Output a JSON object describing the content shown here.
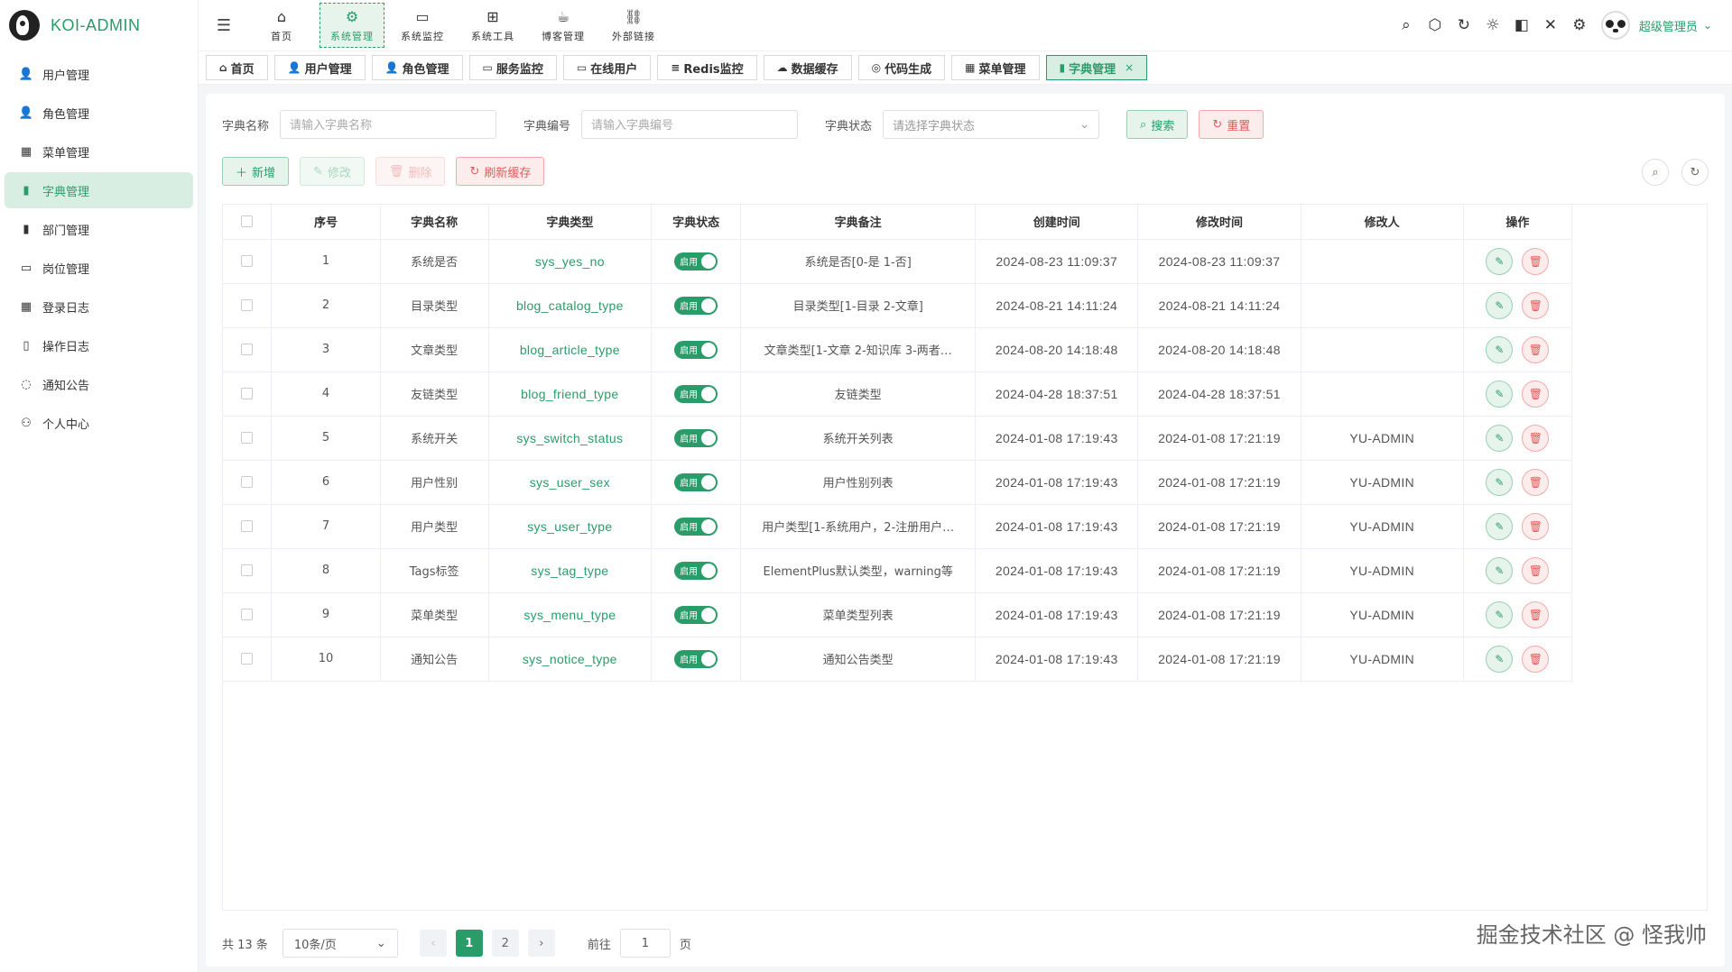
{
  "app": {
    "title": "KOI-ADMIN"
  },
  "sidebar": {
    "items": [
      {
        "label": "用户管理",
        "icon": "user-icon"
      },
      {
        "label": "角色管理",
        "icon": "user-role-icon"
      },
      {
        "label": "菜单管理",
        "icon": "grid-icon"
      },
      {
        "label": "字典管理",
        "icon": "book-icon",
        "active": true
      },
      {
        "label": "部门管理",
        "icon": "bar-chart-icon"
      },
      {
        "label": "岗位管理",
        "icon": "id-card-icon"
      },
      {
        "label": "登录日志",
        "icon": "calendar-icon"
      },
      {
        "label": "操作日志",
        "icon": "notebook-icon"
      },
      {
        "label": "通知公告",
        "icon": "chat-icon"
      },
      {
        "label": "个人中心",
        "icon": "profile-icon"
      }
    ]
  },
  "topnav": {
    "items": [
      {
        "label": "首页",
        "icon": "home-icon"
      },
      {
        "label": "系统管理",
        "icon": "gear-icon",
        "active": true
      },
      {
        "label": "系统监控",
        "icon": "monitor-icon"
      },
      {
        "label": "系统工具",
        "icon": "toolbox-icon"
      },
      {
        "label": "博客管理",
        "icon": "blog-icon"
      },
      {
        "label": "外部链接",
        "icon": "link-icon"
      }
    ]
  },
  "header": {
    "user_name": "超级管理员"
  },
  "tabs": [
    {
      "label": "首页"
    },
    {
      "label": "用户管理"
    },
    {
      "label": "角色管理"
    },
    {
      "label": "服务监控"
    },
    {
      "label": "在线用户"
    },
    {
      "label": "Redis监控"
    },
    {
      "label": "数据缓存"
    },
    {
      "label": "代码生成"
    },
    {
      "label": "菜单管理"
    },
    {
      "label": "字典管理",
      "active": true
    }
  ],
  "search": {
    "name_label": "字典名称",
    "name_placeholder": "请输入字典名称",
    "code_label": "字典编号",
    "code_placeholder": "请输入字典编号",
    "status_label": "字典状态",
    "status_placeholder": "请选择字典状态",
    "search_btn": "搜索",
    "reset_btn": "重置"
  },
  "actions": {
    "add": "新增",
    "edit": "修改",
    "delete": "删除",
    "refresh_cache": "刷新缓存"
  },
  "table": {
    "headers": [
      "序号",
      "字典名称",
      "字典类型",
      "字典状态",
      "字典备注",
      "创建时间",
      "修改时间",
      "修改人",
      "操作"
    ],
    "switch_label": "启用",
    "rows": [
      {
        "no": "1",
        "name": "系统是否",
        "type": "sys_yes_no",
        "remark": "系统是否[0-是 1-否]",
        "created": "2024-08-23 11:09:37",
        "updated": "2024-08-23 11:09:37",
        "modifier": ""
      },
      {
        "no": "2",
        "name": "目录类型",
        "type": "blog_catalog_type",
        "remark": "目录类型[1-目录 2-文章]",
        "created": "2024-08-21 14:11:24",
        "updated": "2024-08-21 14:11:24",
        "modifier": ""
      },
      {
        "no": "3",
        "name": "文章类型",
        "type": "blog_article_type",
        "remark": "文章类型[1-文章 2-知识库 3-两者…",
        "created": "2024-08-20 14:18:48",
        "updated": "2024-08-20 14:18:48",
        "modifier": ""
      },
      {
        "no": "4",
        "name": "友链类型",
        "type": "blog_friend_type",
        "remark": "友链类型",
        "created": "2024-04-28 18:37:51",
        "updated": "2024-04-28 18:37:51",
        "modifier": ""
      },
      {
        "no": "5",
        "name": "系统开关",
        "type": "sys_switch_status",
        "remark": "系统开关列表",
        "created": "2024-01-08 17:19:43",
        "updated": "2024-01-08 17:21:19",
        "modifier": "YU-ADMIN"
      },
      {
        "no": "6",
        "name": "用户性别",
        "type": "sys_user_sex",
        "remark": "用户性别列表",
        "created": "2024-01-08 17:19:43",
        "updated": "2024-01-08 17:21:19",
        "modifier": "YU-ADMIN"
      },
      {
        "no": "7",
        "name": "用户类型",
        "type": "sys_user_type",
        "remark": "用户类型[1-系统用户，2-注册用户…",
        "created": "2024-01-08 17:19:43",
        "updated": "2024-01-08 17:21:19",
        "modifier": "YU-ADMIN"
      },
      {
        "no": "8",
        "name": "Tags标签",
        "type": "sys_tag_type",
        "remark": "ElementPlus默认类型，warning等",
        "created": "2024-01-08 17:19:43",
        "updated": "2024-01-08 17:21:19",
        "modifier": "YU-ADMIN"
      },
      {
        "no": "9",
        "name": "菜单类型",
        "type": "sys_menu_type",
        "remark": "菜单类型列表",
        "created": "2024-01-08 17:19:43",
        "updated": "2024-01-08 17:21:19",
        "modifier": "YU-ADMIN"
      },
      {
        "no": "10",
        "name": "通知公告",
        "type": "sys_notice_type",
        "remark": "通知公告类型",
        "created": "2024-01-08 17:19:43",
        "updated": "2024-01-08 17:21:19",
        "modifier": "YU-ADMIN"
      }
    ]
  },
  "pagination": {
    "total_text": "共 13 条",
    "page_size": "10条/页",
    "pages": [
      "1",
      "2"
    ],
    "current": "1",
    "goto_label": "前往",
    "goto_value": "1",
    "goto_suffix": "页"
  },
  "watermark": "掘金技术社区 @ 怪我帅",
  "colors": {
    "accent": "#2a9c6a",
    "danger": "#e25a5a"
  }
}
